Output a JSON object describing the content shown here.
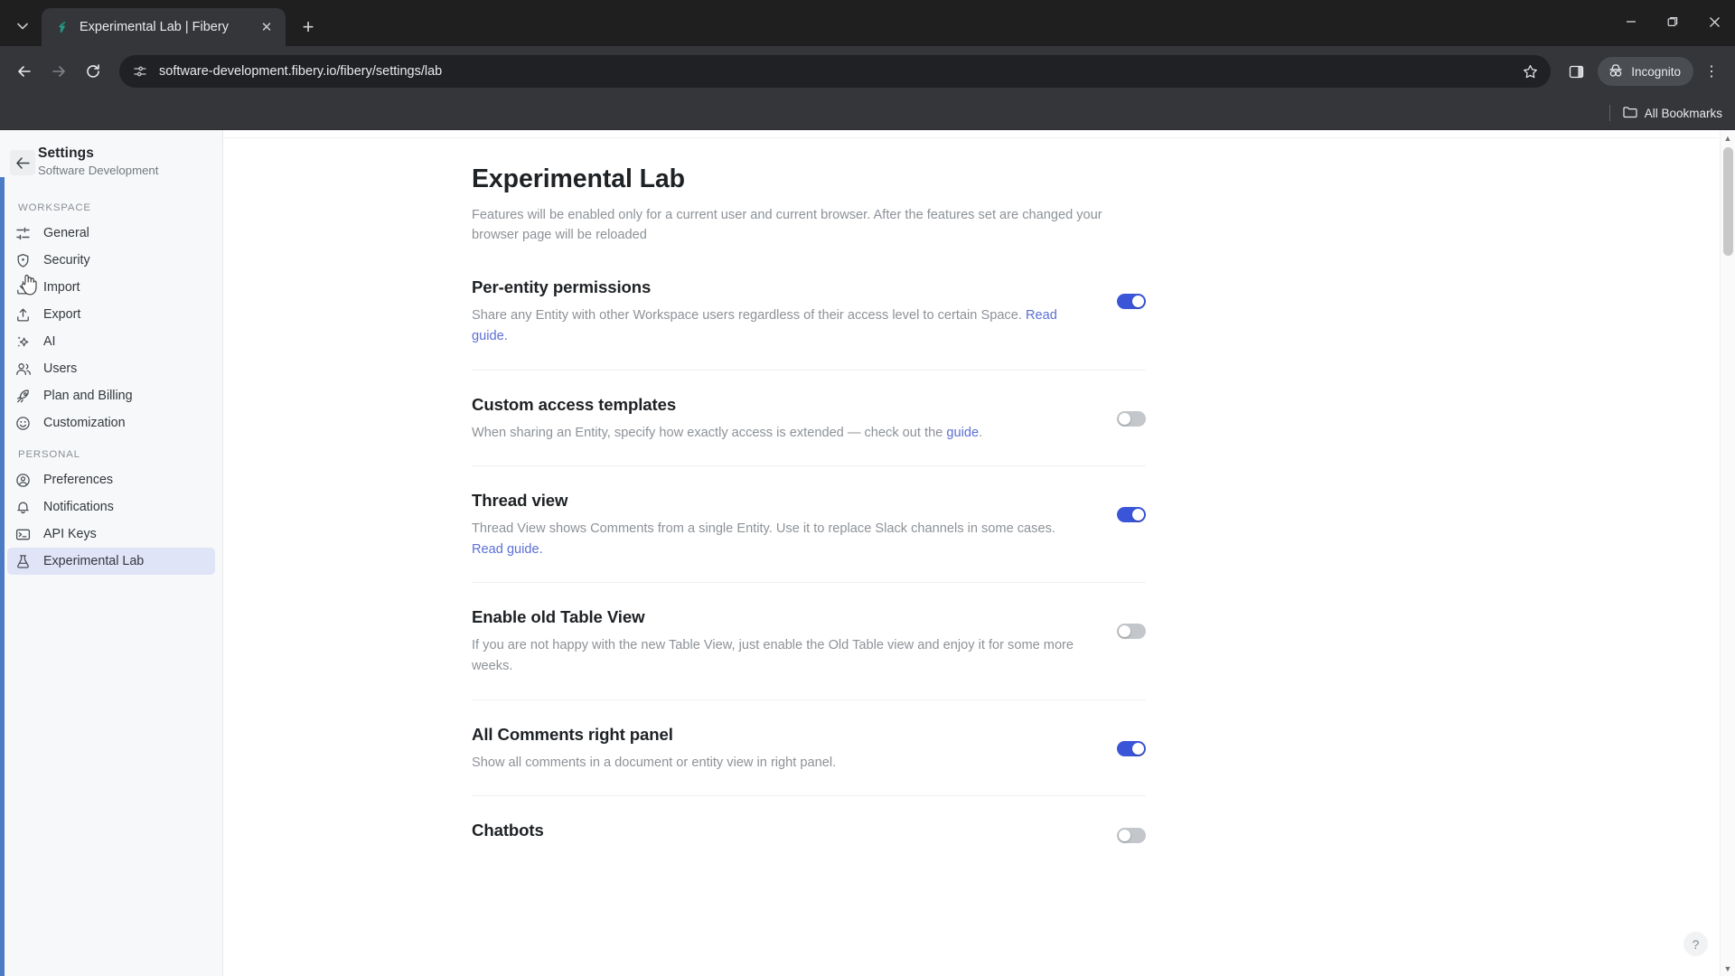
{
  "browser": {
    "tab": {
      "title": "Experimental Lab | Fibery",
      "favicon_name": "fibery-logo-icon",
      "close_label": "✕"
    },
    "new_tab_label": "+",
    "tab_search_label": "⌄",
    "window_controls": {
      "minimize": "—",
      "maximize": "❐",
      "close": "✕"
    },
    "toolbar": {
      "back_label": "←",
      "forward_label": "→",
      "reload_label": "⟳",
      "url": "software-development.fibery.io/fibery/settings/lab",
      "url_placeholder": "Search Google or type a URL",
      "site_info_icon": "site-settings-icon",
      "bookmark_star_label": "☆",
      "side_panel_icon": "side-panel-icon",
      "incognito_label": "Incognito",
      "menu_label": "⋮"
    },
    "bookmarks": {
      "all_bookmarks_label": "All Bookmarks",
      "folder_icon": "folder-icon"
    }
  },
  "sidebar": {
    "back_icon": "arrow-left-icon",
    "title": "Settings",
    "subtitle": "Software Development",
    "groups": [
      {
        "label": "Workspace",
        "items": [
          {
            "label": "General",
            "icon": "sliders-icon",
            "active": false
          },
          {
            "label": "Security",
            "icon": "shield-icon",
            "active": false
          },
          {
            "label": "Import",
            "icon": "import-icon",
            "active": false
          },
          {
            "label": "Export",
            "icon": "export-icon",
            "active": false
          },
          {
            "label": "AI",
            "icon": "sparkle-icon",
            "active": false
          },
          {
            "label": "Users",
            "icon": "users-icon",
            "active": false
          },
          {
            "label": "Plan and Billing",
            "icon": "rocket-icon",
            "active": false
          },
          {
            "label": "Customization",
            "icon": "smiley-icon",
            "active": false
          }
        ]
      },
      {
        "label": "Personal",
        "items": [
          {
            "label": "Preferences",
            "icon": "user-circle-icon",
            "active": false
          },
          {
            "label": "Notifications",
            "icon": "bell-icon",
            "active": false
          },
          {
            "label": "API Keys",
            "icon": "terminal-icon",
            "active": false
          },
          {
            "label": "Experimental Lab",
            "icon": "flask-icon",
            "active": true
          }
        ]
      }
    ]
  },
  "main": {
    "title": "Experimental Lab",
    "description": "Features will be enabled only for a current user and current browser. After the features set are changed your browser page will be reloaded",
    "features": [
      {
        "title": "Per-entity permissions",
        "desc_before": "Share any Entity with other Workspace users regardless of their access level to certain Space. ",
        "link_text": "Read guide.",
        "desc_after": "",
        "enabled": true
      },
      {
        "title": "Custom access templates",
        "desc_before": "When sharing an Entity, specify how exactly access is extended — check out the ",
        "link_text": "guide",
        "desc_after": ".",
        "enabled": false
      },
      {
        "title": "Thread view",
        "desc_before": "Thread View shows Comments from a single Entity. Use it to replace Slack channels in some cases. ",
        "link_text": "Read guide.",
        "desc_after": "",
        "enabled": true
      },
      {
        "title": "Enable old Table View",
        "desc_before": "If you are not happy with the new Table View, just enable the Old Table view and enjoy it for some more weeks.",
        "link_text": "",
        "desc_after": "",
        "enabled": false
      },
      {
        "title": "All Comments right panel",
        "desc_before": "Show all comments in a document or entity view in right panel.",
        "link_text": "",
        "desc_after": "",
        "enabled": true
      },
      {
        "title": "Chatbots",
        "desc_before": "",
        "link_text": "",
        "desc_after": "",
        "enabled": false
      }
    ],
    "help_label": "?"
  },
  "scrollbar": {
    "up_label": "▲",
    "down_label": "▼"
  },
  "colors": {
    "toggle_on": "#3b55d9",
    "toggle_off": "#c3c6ca",
    "link": "#5b6fd6",
    "sidebar_active": "#dfe4f7",
    "sidebar_accent": "#4b7bc4"
  }
}
